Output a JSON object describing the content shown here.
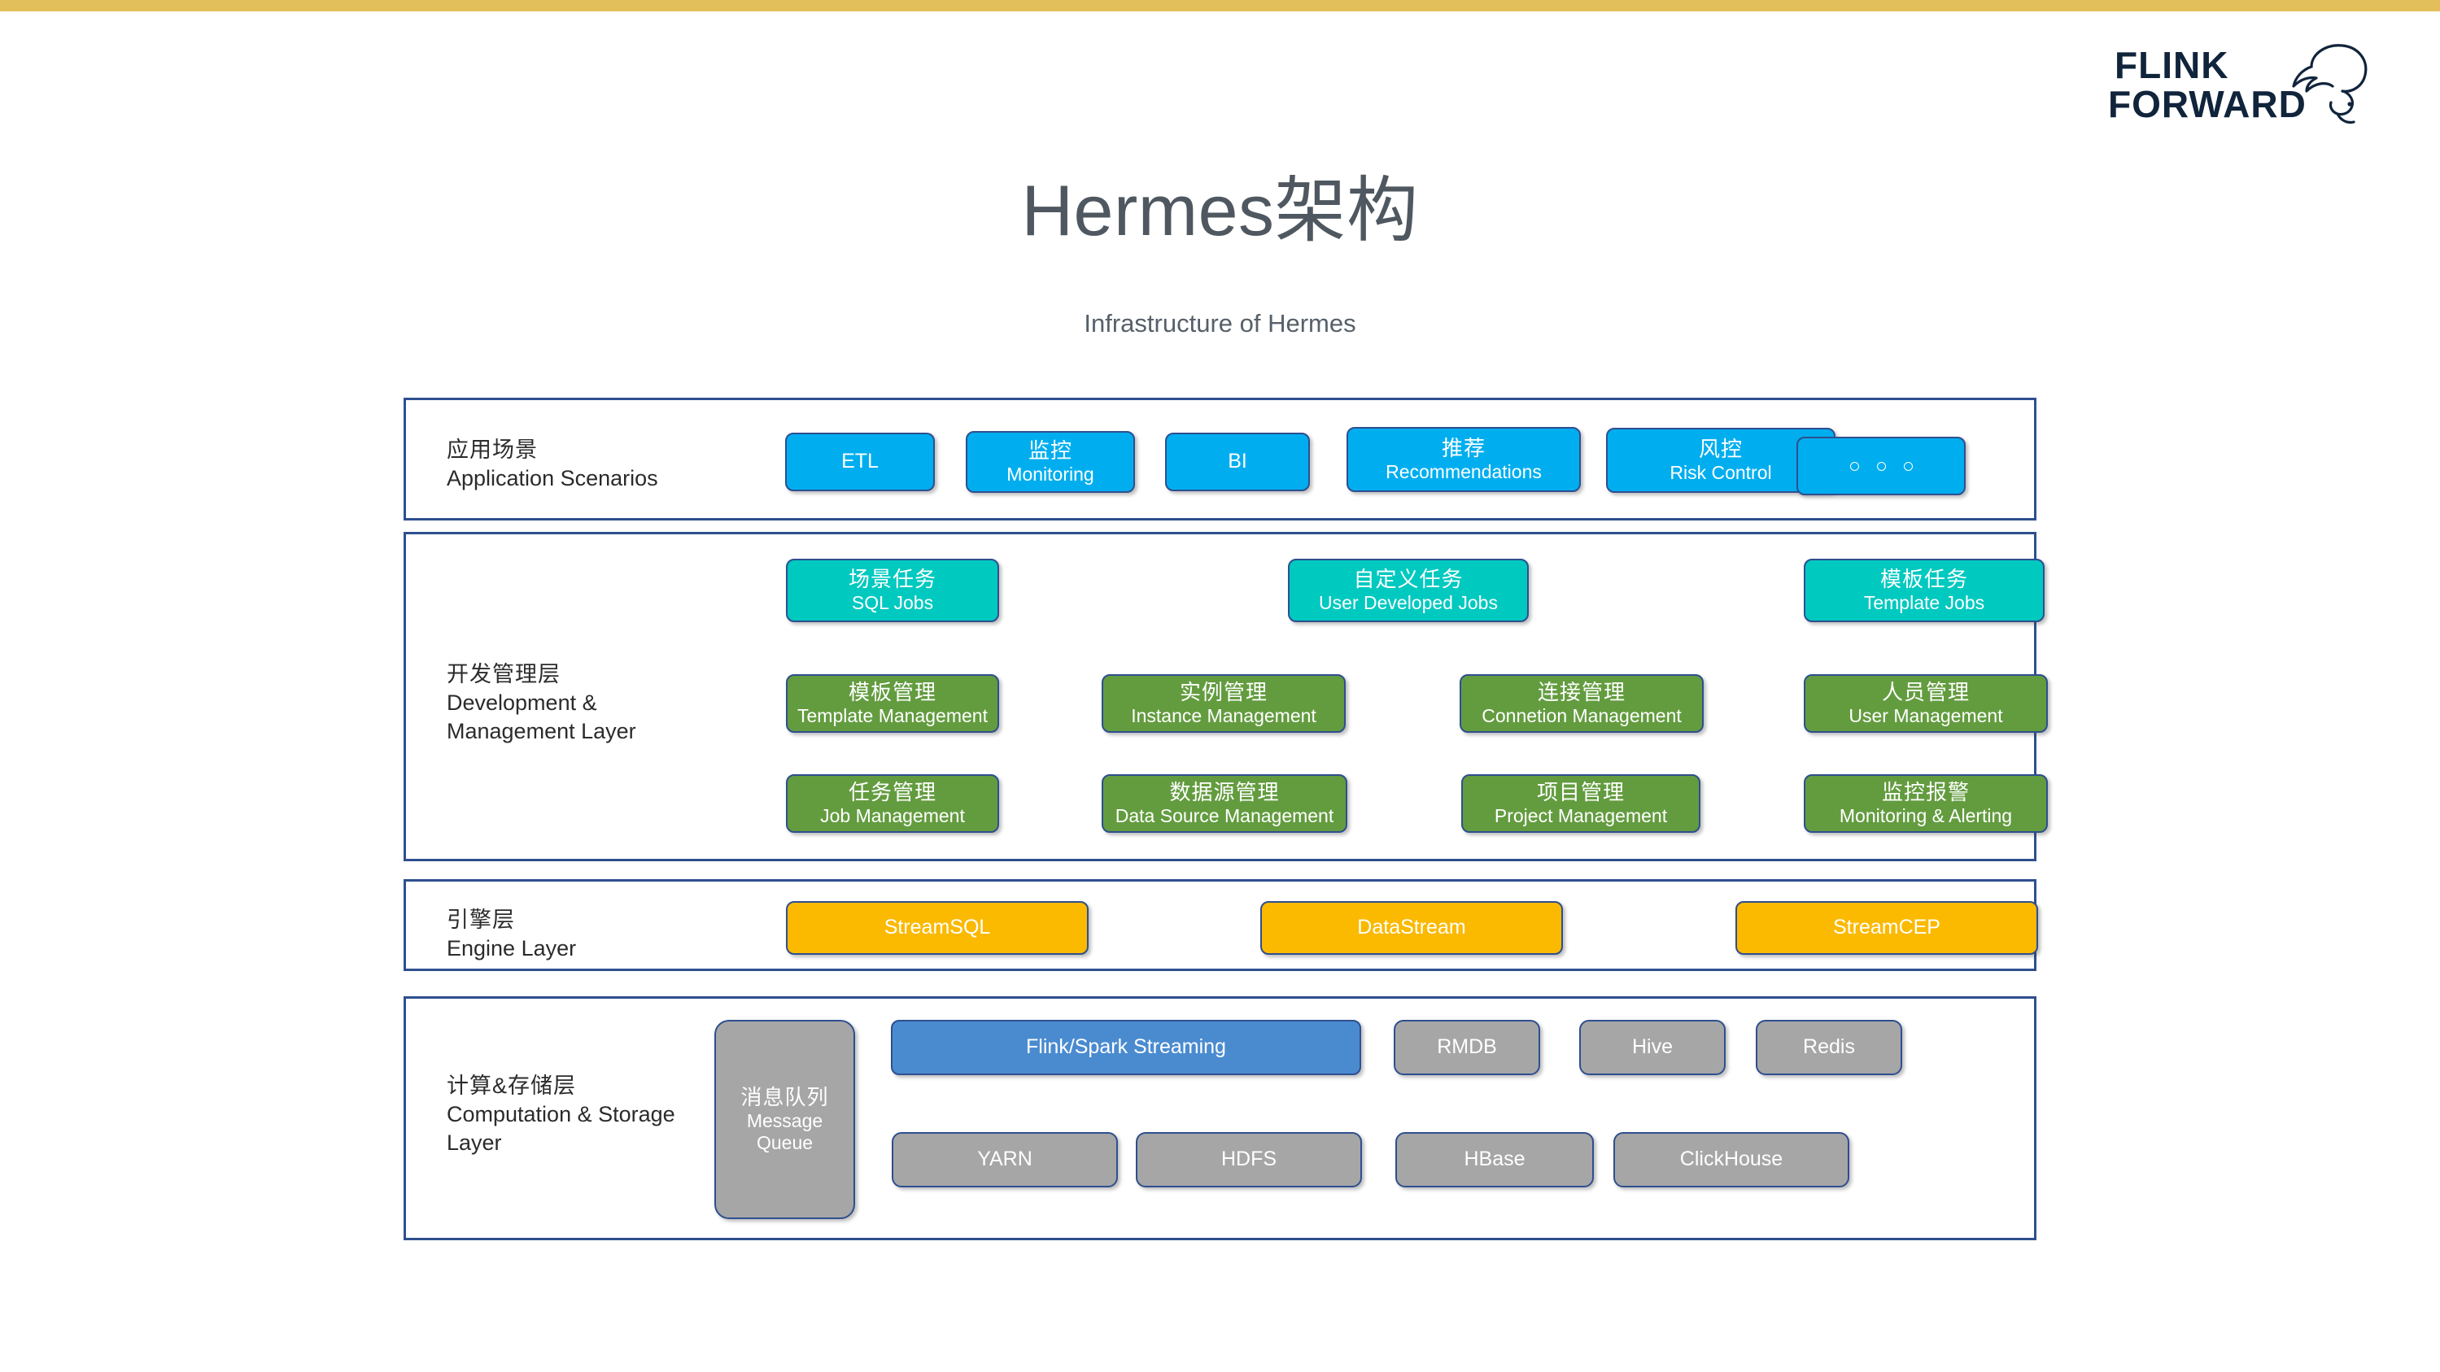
{
  "accent_color": "#e2bf5a",
  "brand": {
    "line1": "FLINK",
    "line2": "FORWARD",
    "icon": "squirrel-icon",
    "color": "#10243b"
  },
  "title": "Hermes架构",
  "subtitle": "Infrastructure of Hermes",
  "colors": {
    "border": "#2e4f8f",
    "blue": "#00aeef",
    "teal": "#00c9c0",
    "green": "#639c3f",
    "amber": "#fbb900",
    "steel": "#4a8bd0",
    "gray": "#a6a6a6"
  },
  "layers": [
    {
      "id": "application",
      "label_zh": "应用场景",
      "label_en": "Application Scenarios",
      "nodes": [
        {
          "zh": "",
          "en": "ETL",
          "color": "blue"
        },
        {
          "zh": "监控",
          "en": "Monitoring",
          "color": "blue"
        },
        {
          "zh": "",
          "en": "BI",
          "color": "blue"
        },
        {
          "zh": "推荐",
          "en": "Recommendations",
          "color": "blue"
        },
        {
          "zh": "风控",
          "en": "Risk Control",
          "color": "blue"
        },
        {
          "zh": "",
          "en": "",
          "color": "blue",
          "dots": "○ ○ ○"
        }
      ]
    },
    {
      "id": "development",
      "label_zh": "开发管理层",
      "label_en": "Development &",
      "label_en2": "Management Layer",
      "row_jobs": [
        {
          "zh": "场景任务",
          "en": "SQL Jobs",
          "color": "teal"
        },
        {
          "zh": "自定义任务",
          "en": "User Developed Jobs",
          "color": "teal"
        },
        {
          "zh": "模板任务",
          "en": "Template Jobs",
          "color": "teal"
        }
      ],
      "row_mgmt1": [
        {
          "zh": "模板管理",
          "en": "Template Management",
          "color": "green"
        },
        {
          "zh": "实例管理",
          "en": "Instance Management",
          "color": "green"
        },
        {
          "zh": "连接管理",
          "en": "Connetion Management",
          "color": "green"
        },
        {
          "zh": "人员管理",
          "en": "User Management",
          "color": "green"
        }
      ],
      "row_mgmt2": [
        {
          "zh": "任务管理",
          "en": "Job Management",
          "color": "green"
        },
        {
          "zh": "数据源管理",
          "en": "Data Source Management",
          "color": "green"
        },
        {
          "zh": "项目管理",
          "en": "Project Management",
          "color": "green"
        },
        {
          "zh": "监控报警",
          "en": "Monitoring & Alerting",
          "color": "green"
        }
      ]
    },
    {
      "id": "engine",
      "label_zh": "引擎层",
      "label_en": "Engine Layer",
      "nodes": [
        {
          "en": "StreamSQL",
          "color": "amber"
        },
        {
          "en": "DataStream",
          "color": "amber"
        },
        {
          "en": "StreamCEP",
          "color": "amber"
        }
      ]
    },
    {
      "id": "storage",
      "label_zh": "计算&存储层",
      "label_en": "Computation & Storage",
      "label_en2": "Layer",
      "message_queue": {
        "zh": "消息队列",
        "en1": "Message",
        "en2": "Queue",
        "color": "gray"
      },
      "row_top": [
        {
          "en": "Flink/Spark Streaming",
          "color": "steel"
        },
        {
          "en": "RMDB",
          "color": "gray"
        },
        {
          "en": "Hive",
          "color": "gray"
        },
        {
          "en": "Redis",
          "color": "gray"
        }
      ],
      "row_bottom": [
        {
          "en": "YARN",
          "color": "gray"
        },
        {
          "en": "HDFS",
          "color": "gray"
        },
        {
          "en": "HBase",
          "color": "gray"
        },
        {
          "en": "ClickHouse",
          "color": "gray"
        }
      ]
    }
  ]
}
